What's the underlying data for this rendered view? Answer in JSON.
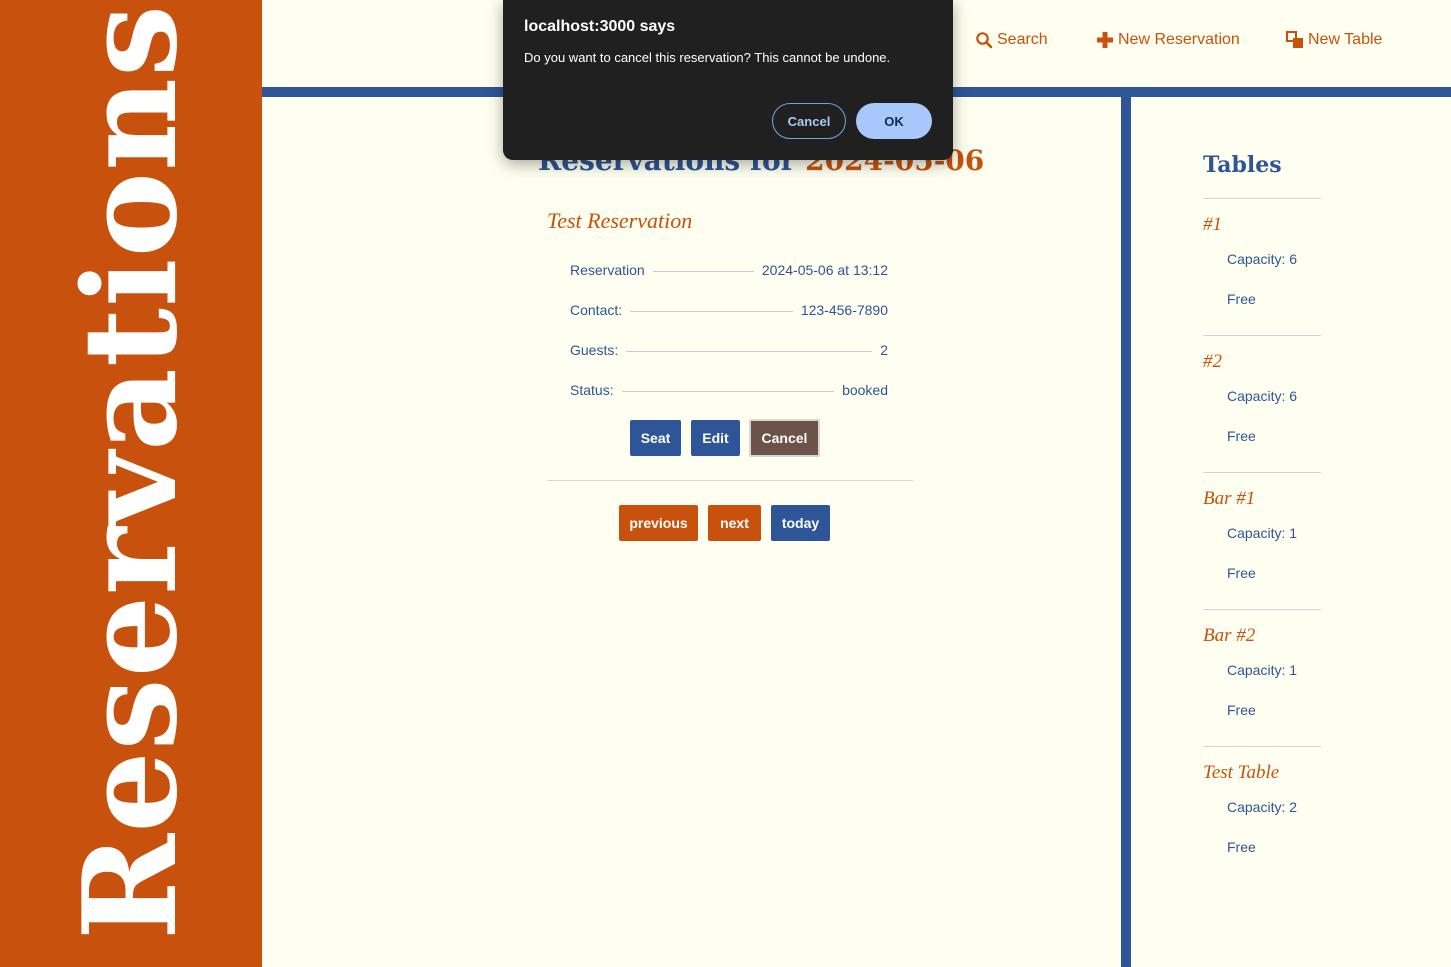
{
  "sidebar": {
    "title": "Reservations"
  },
  "nav": {
    "search": "Search",
    "new_reservation": "New Reservation",
    "new_table": "New Table"
  },
  "main": {
    "title_prefix": "Reservations for",
    "date": "2024-05-06",
    "reservation": {
      "name": "Test Reservation",
      "details": [
        {
          "label": "Reservation",
          "value": "2024-05-06 at 13:12"
        },
        {
          "label": "Contact:",
          "value": "123-456-7890"
        },
        {
          "label": "Guests:",
          "value": "2"
        },
        {
          "label": "Status:",
          "value": "booked"
        }
      ],
      "buttons": {
        "seat": "Seat",
        "edit": "Edit",
        "cancel": "Cancel"
      }
    },
    "pager": {
      "previous": "previous",
      "next": "next",
      "today": "today"
    }
  },
  "tables": {
    "title": "Tables",
    "items": [
      {
        "name": "#1",
        "capacity": "Capacity: 6",
        "status": "Free"
      },
      {
        "name": "#2",
        "capacity": "Capacity: 6",
        "status": "Free"
      },
      {
        "name": "Bar #1",
        "capacity": "Capacity: 1",
        "status": "Free"
      },
      {
        "name": "Bar #2",
        "capacity": "Capacity: 1",
        "status": "Free"
      },
      {
        "name": "Test Table",
        "capacity": "Capacity: 2",
        "status": "Free"
      }
    ]
  },
  "dialog": {
    "title": "localhost:3000 says",
    "message": "Do you want to cancel this reservation? This cannot be undone.",
    "cancel": "Cancel",
    "ok": "OK"
  },
  "colors": {
    "orange": "#c8520d",
    "blue": "#2e5597",
    "background": "#fefff0",
    "dialog_bg": "#202020",
    "ok_button": "#a8c7fa"
  },
  "icons": [
    "search-icon",
    "plus-icon",
    "new-table-icon"
  ]
}
